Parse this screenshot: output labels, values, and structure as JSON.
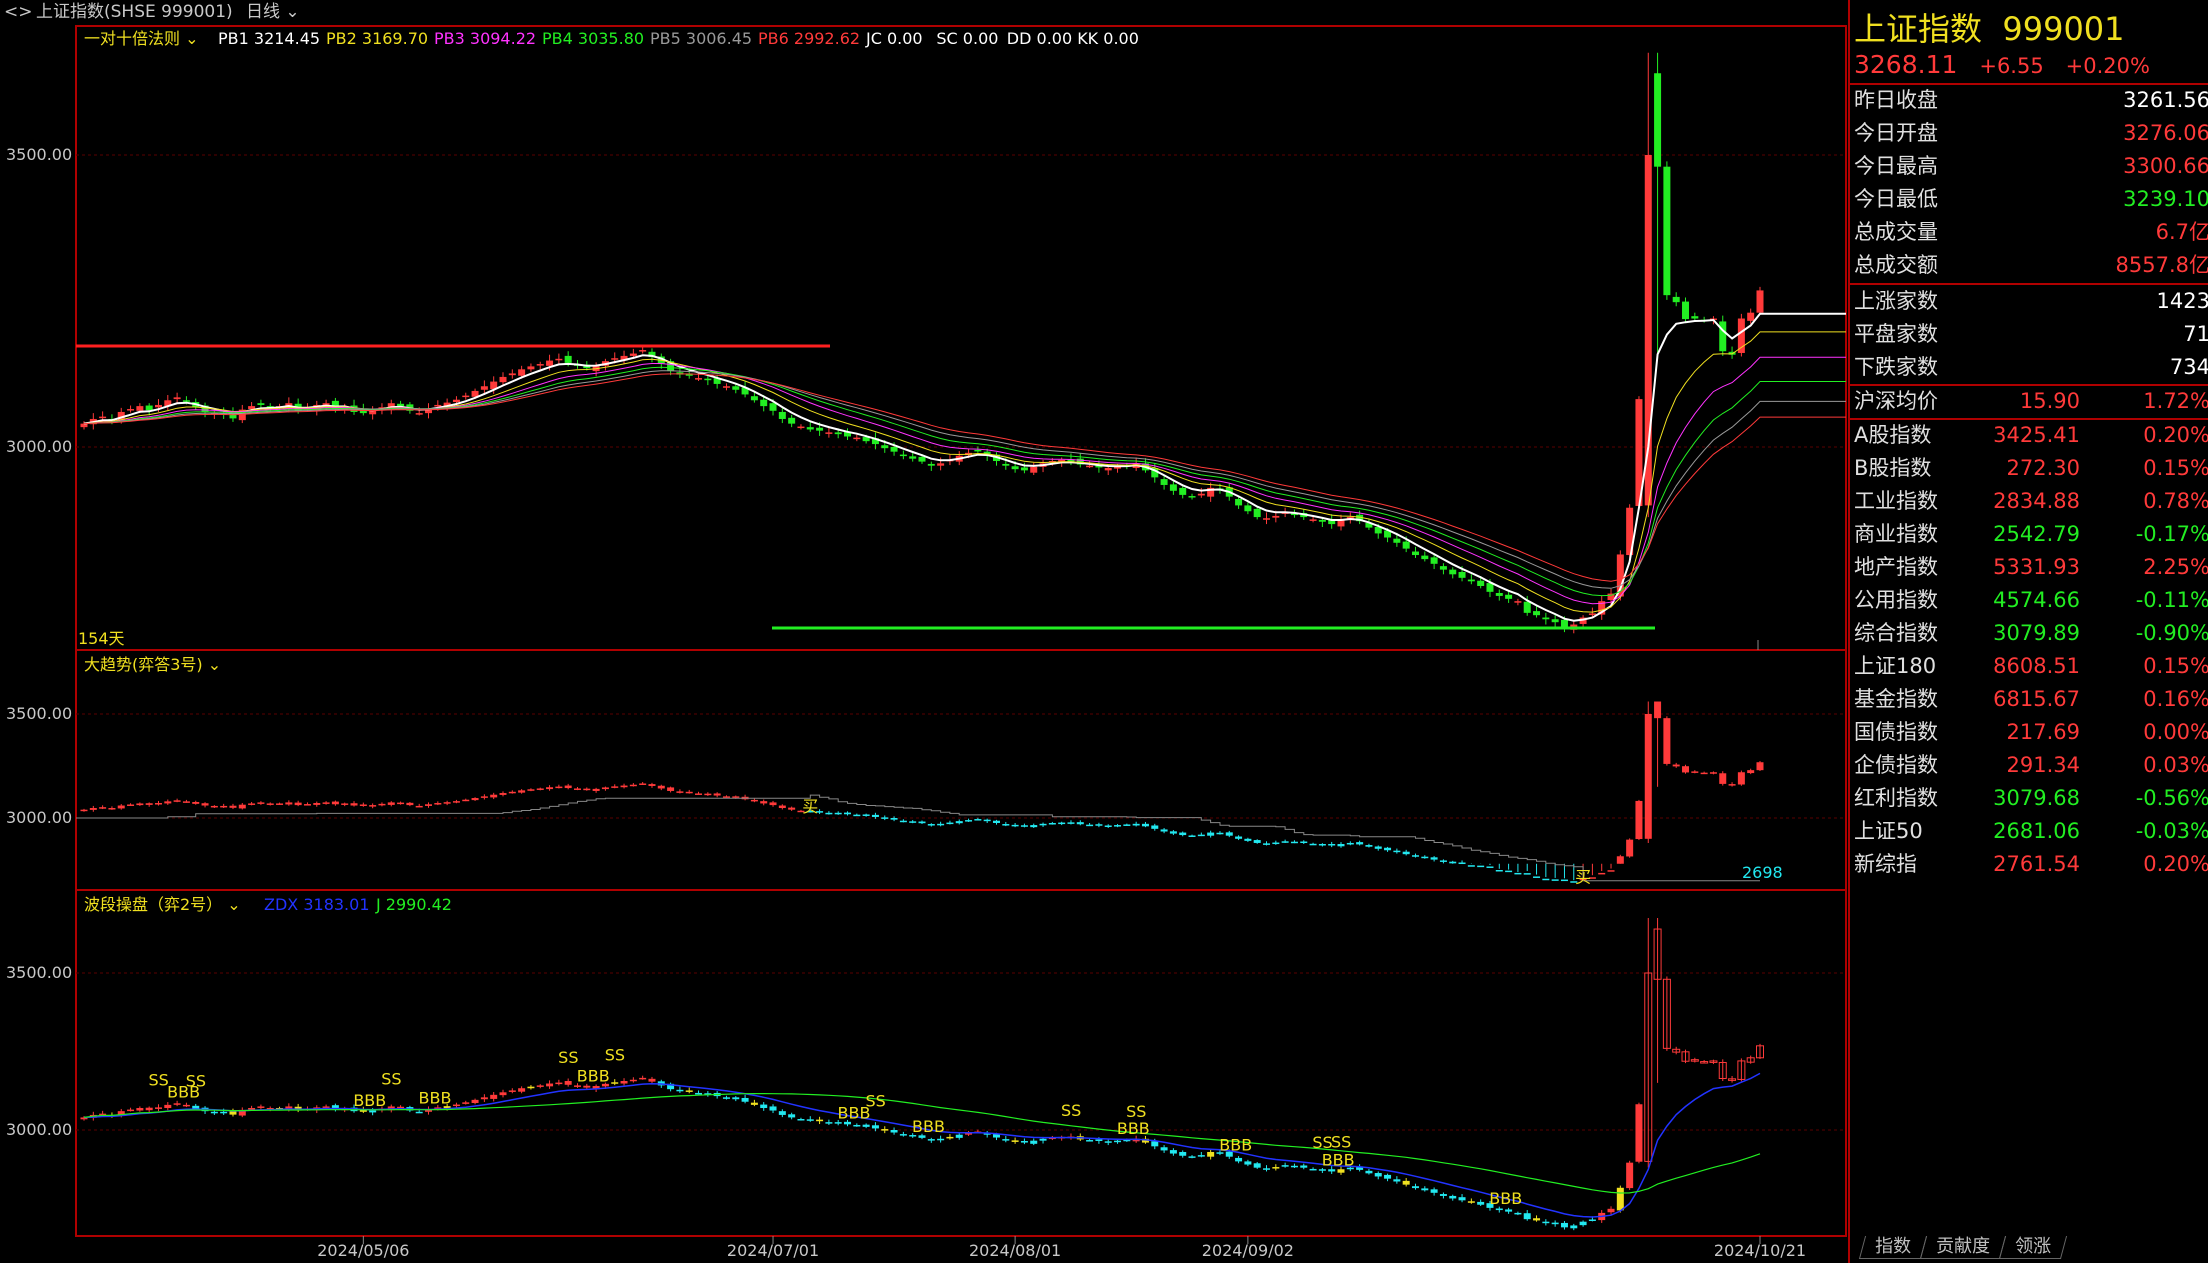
{
  "titlebar": {
    "title": "上证指数(SHSE 999001)",
    "period": "日线"
  },
  "colors": {
    "up": "#ff3a3a",
    "down": "#22ee22",
    "cyan": "#22e8f0",
    "yellow": "#f0e020",
    "grid": "#5a0000",
    "frame": "#b00000"
  },
  "panels": [
    {
      "name": "一对十倍法则",
      "legend": [
        {
          "label": "PB1",
          "value": "3214.45",
          "color": "#ffffff"
        },
        {
          "label": "PB2",
          "value": "3169.70",
          "color": "#f0e020"
        },
        {
          "label": "PB3",
          "value": "3094.22",
          "color": "#ff33ff"
        },
        {
          "label": "PB4",
          "value": "3035.80",
          "color": "#22ee22"
        },
        {
          "label": "PB5",
          "value": "3006.45",
          "color": "#999999"
        },
        {
          "label": "PB6",
          "value": "2992.62",
          "color": "#ff3a3a"
        },
        {
          "label": "JC",
          "value": "0.00",
          "color": "#ffffff"
        },
        {
          "label": "SC",
          "value": "0.00",
          "color": "#ffffff"
        },
        {
          "label": "DD",
          "value": "0.00",
          "color": "#ffffff"
        },
        {
          "label": "KK",
          "value": "0.00",
          "color": "#ffffff"
        }
      ],
      "note": "154天"
    },
    {
      "name": "大趋势(弈答3号)",
      "legend": [],
      "buy_marker": "买",
      "level_label": "2698"
    },
    {
      "name": "波段操盘（弈2号）",
      "legend": [
        {
          "label": "ZDX",
          "value": "3183.01",
          "color": "#2233ff"
        },
        {
          "label": "J",
          "value": "2990.42",
          "color": "#22ee22"
        }
      ],
      "signals": [
        "SS",
        "BBB"
      ]
    }
  ],
  "chart_data": {
    "type": "candlestick",
    "title": "上证指数(SHSE 999001)",
    "yticks": [
      "3500.00",
      "3000.00"
    ],
    "xticks": [
      "2024/05/06",
      "2024/07/01",
      "2024/08/01",
      "2024/09/02",
      "2024/10/21"
    ],
    "resistance_level": 3173,
    "support_level": 2690,
    "closes": [
      3040,
      3048,
      3052,
      3046,
      3060,
      3065,
      3070,
      3063,
      3072,
      3080,
      3085,
      3078,
      3068,
      3060,
      3058,
      3055,
      3049,
      3064,
      3070,
      3072,
      3068,
      3070,
      3075,
      3062,
      3067,
      3072,
      3075,
      3066,
      3070,
      3060,
      3058,
      3062,
      3068,
      3075,
      3070,
      3062,
      3058,
      3066,
      3072,
      3076,
      3081,
      3088,
      3096,
      3104,
      3112,
      3120,
      3126,
      3133,
      3138,
      3142,
      3148,
      3151,
      3144,
      3139,
      3135,
      3140,
      3147,
      3152,
      3156,
      3160,
      3166,
      3154,
      3142,
      3130,
      3124,
      3122,
      3118,
      3115,
      3108,
      3104,
      3098,
      3090,
      3080,
      3070,
      3062,
      3048,
      3040,
      3035,
      3030,
      3028,
      3025,
      3022,
      3018,
      3016,
      3010,
      3005,
      2998,
      2992,
      2985,
      2980,
      2975,
      2968,
      2972,
      2978,
      2985,
      2990,
      2994,
      2985,
      2976,
      2968,
      2962,
      2960,
      2966,
      2972,
      2976,
      2978,
      2975,
      2970,
      2968,
      2965,
      2964,
      2966,
      2968,
      2972,
      2960,
      2948,
      2935,
      2925,
      2918,
      2915,
      2920,
      2930,
      2928,
      2915,
      2900,
      2890,
      2880,
      2878,
      2882,
      2888,
      2885,
      2880,
      2876,
      2872,
      2868,
      2875,
      2880,
      2873,
      2862,
      2852,
      2845,
      2836,
      2826,
      2815,
      2808,
      2800,
      2790,
      2782,
      2776,
      2770,
      2762,
      2752,
      2745,
      2740,
      2736,
      2716,
      2712,
      2705,
      2700,
      2690,
      2696,
      2708,
      2715,
      2736,
      2749,
      2816,
      2896,
      3082,
      3208,
      3476,
      3260,
      3248,
      3219,
      3220,
      3217,
      3220,
      3164,
      3158,
      3220,
      3230,
      3268.11
    ],
    "current": {
      "last": "3268.11",
      "change": "+6.55",
      "pct": "+0.20%"
    }
  },
  "side": {
    "title": "上证指数",
    "code": "999001",
    "price": "3268.11",
    "change": "+6.55",
    "pct": "+0.20%",
    "stats": [
      {
        "label": "昨日收盘",
        "value": "3261.56",
        "color": "white"
      },
      {
        "label": "今日开盘",
        "value": "3276.06",
        "color": "red"
      },
      {
        "label": "今日最高",
        "value": "3300.66",
        "color": "red"
      },
      {
        "label": "今日最低",
        "value": "3239.10",
        "color": "green"
      },
      {
        "label": "总成交量",
        "value": "6.7亿",
        "color": "red"
      },
      {
        "label": "总成交额",
        "value": "8557.8亿",
        "color": "red"
      }
    ],
    "breadth": [
      {
        "label": "上涨家数",
        "value": "1423",
        "color": "white"
      },
      {
        "label": "平盘家数",
        "value": "71",
        "color": "white"
      },
      {
        "label": "下跌家数",
        "value": "734",
        "color": "white"
      }
    ],
    "avg": {
      "label": "沪深均价",
      "value": "15.90",
      "pct": "1.72%"
    },
    "indices": [
      {
        "label": "A股指数",
        "value": "3425.41",
        "pct": "0.20%",
        "color": "red"
      },
      {
        "label": "B股指数",
        "value": "272.30",
        "pct": "0.15%",
        "color": "red"
      },
      {
        "label": "工业指数",
        "value": "2834.88",
        "pct": "0.78%",
        "color": "red"
      },
      {
        "label": "商业指数",
        "value": "2542.79",
        "pct": "-0.17%",
        "color": "green"
      },
      {
        "label": "地产指数",
        "value": "5331.93",
        "pct": "2.25%",
        "color": "red"
      },
      {
        "label": "公用指数",
        "value": "4574.66",
        "pct": "-0.11%",
        "color": "green"
      },
      {
        "label": "综合指数",
        "value": "3079.89",
        "pct": "-0.90%",
        "color": "green"
      },
      {
        "label": "上证180",
        "value": "8608.51",
        "pct": "0.15%",
        "color": "red"
      },
      {
        "label": "基金指数",
        "value": "6815.67",
        "pct": "0.16%",
        "color": "red"
      },
      {
        "label": "国债指数",
        "value": "217.69",
        "pct": "0.00%",
        "color": "red"
      },
      {
        "label": "企债指数",
        "value": "291.34",
        "pct": "0.03%",
        "color": "red"
      },
      {
        "label": "红利指数",
        "value": "3079.68",
        "pct": "-0.56%",
        "color": "green"
      },
      {
        "label": "上证50",
        "value": "2681.06",
        "pct": "-0.03%",
        "color": "green"
      },
      {
        "label": "新综指",
        "value": "2761.54",
        "pct": "0.20%",
        "color": "red"
      }
    ]
  },
  "tabs": [
    "指数",
    "贡献度",
    "领涨"
  ]
}
